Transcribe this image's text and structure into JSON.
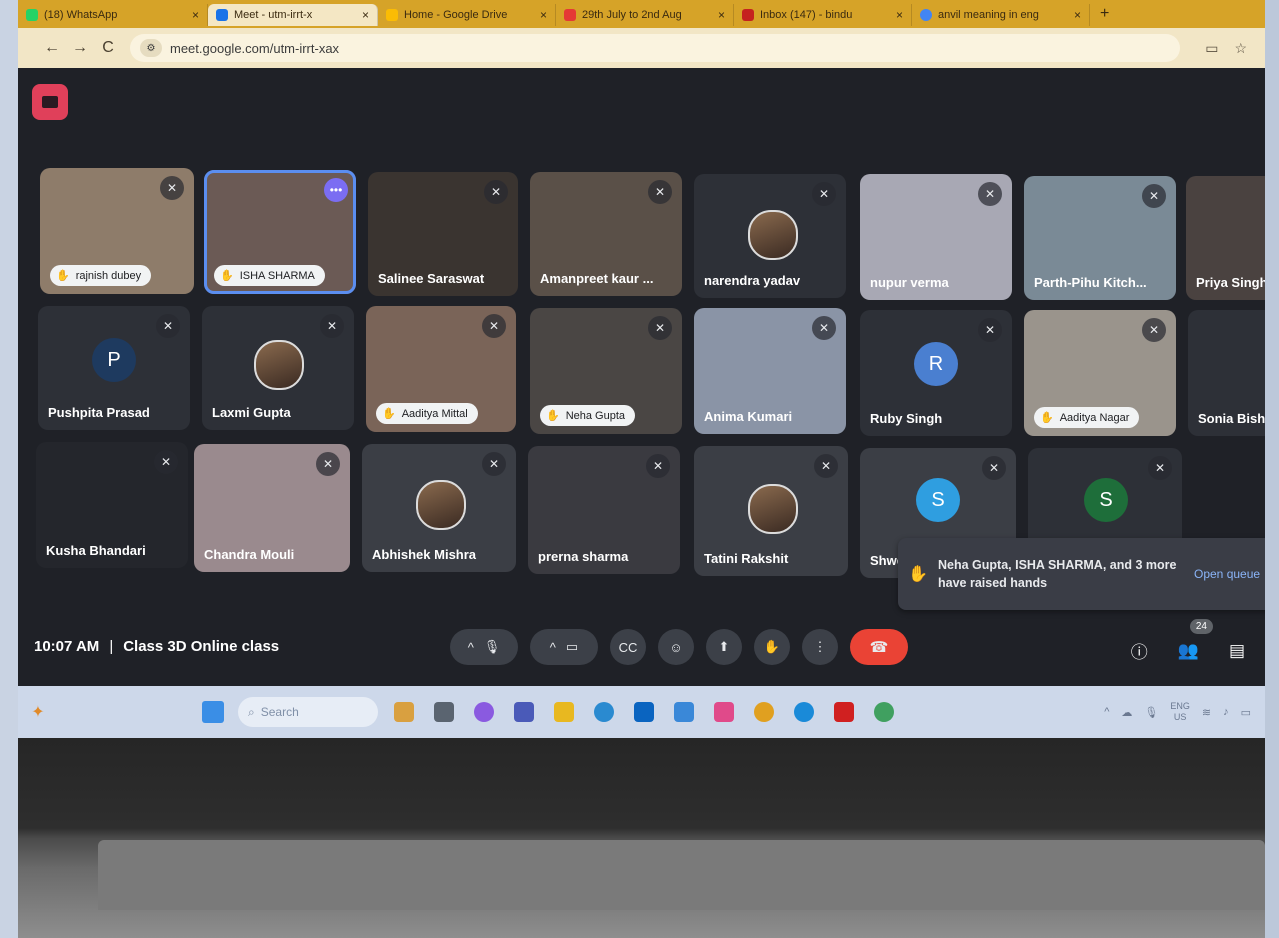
{
  "browser": {
    "tabs": [
      {
        "label": "(18) WhatsApp",
        "color": "#25d366",
        "active": false
      },
      {
        "label": "Meet - utm-irrt-x",
        "color": "#1a73e8",
        "active": true
      },
      {
        "label": "Home - Google Drive",
        "color": "#fbbc04",
        "active": false
      },
      {
        "label": "29th July to 2nd Aug",
        "color": "#e53935",
        "active": false
      },
      {
        "label": "Inbox (147) - bindu",
        "color": "#c5221f",
        "active": false
      },
      {
        "label": "anvil meaning in eng",
        "color": "#4285f4",
        "active": false
      }
    ],
    "new_tab": "+",
    "back": "←",
    "forward": "→",
    "reload": "C",
    "url": "meet.google.com/utm-irrt-xax"
  },
  "meet": {
    "tiles": [
      {
        "name": "rajnish dubey",
        "style": "pill",
        "bg": "#8e7c6a"
      },
      {
        "name": "ISHA SHARMA",
        "style": "pill",
        "bg": "#6b5a55"
      },
      {
        "name": "Salinee Saraswat",
        "style": "text",
        "bg": "#3a3430"
      },
      {
        "name": "Amanpreet kaur ...",
        "style": "text",
        "bg": "#5a5048"
      },
      {
        "name": "narendra yadav",
        "style": "text",
        "bg": "#303238"
      },
      {
        "name": "nupur verma",
        "style": "text",
        "bg": "#a8a8b4"
      },
      {
        "name": "Parth-Pihu Kitch...",
        "style": "text",
        "bg": "#7a8a96"
      },
      {
        "name": "Priya Singh",
        "style": "text",
        "bg": "#4a4240"
      },
      {
        "name": "Pushpita Prasad",
        "style": "avatar",
        "letter": "P",
        "avatar_color": "#1e3a5f",
        "bg": "#2d3037"
      },
      {
        "name": "Laxmi Gupta",
        "style": "photo",
        "bg": "#2d3037"
      },
      {
        "name": "Aaditya Mittal",
        "style": "pill",
        "bg": "#7a6458"
      },
      {
        "name": "Neha Gupta",
        "style": "pill",
        "bg": "#4a4644"
      },
      {
        "name": "Anima Kumari",
        "style": "text",
        "bg": "#8a94a6"
      },
      {
        "name": "Ruby Singh",
        "style": "avatar",
        "letter": "R",
        "avatar_color": "#4a7fd0",
        "bg": "#2d3037"
      },
      {
        "name": "Aaditya Nagar",
        "style": "pill",
        "bg": "#9a948c"
      },
      {
        "name": "Sonia Bisht",
        "style": "text",
        "bg": "#2d3037"
      },
      {
        "name": "Kusha Bhandari",
        "style": "text",
        "bg": "#24262c"
      },
      {
        "name": "Chandra Mouli",
        "style": "text",
        "bg": "#9a8a8e"
      },
      {
        "name": "Abhishek Mishra",
        "style": "photo",
        "bg": "#3b3e45"
      },
      {
        "name": "prerna sharma",
        "style": "text",
        "bg": "#3a3a40"
      },
      {
        "name": "Tatini Rakshit",
        "style": "photo",
        "bg": "#3b3e45"
      },
      {
        "name": "Shweta",
        "style": "avatar",
        "letter": "S",
        "avatar_color": "#2f9ee0",
        "bg": "#3b3e45"
      },
      {
        "name": "",
        "style": "avatar",
        "letter": "S",
        "avatar_color": "#1e6e3a",
        "bg": "#2d3037"
      }
    ],
    "toast": {
      "text": "Neha Gupta, ISHA SHARMA, and 3 more have raised hands",
      "link": "Open queue"
    },
    "time": "10:07 AM",
    "separator": "|",
    "meeting_title": "Class 3D Online class",
    "people_count": "24"
  },
  "taskbar": {
    "search_placeholder": "Search",
    "lang_line1": "ENG",
    "lang_line2": "US"
  }
}
